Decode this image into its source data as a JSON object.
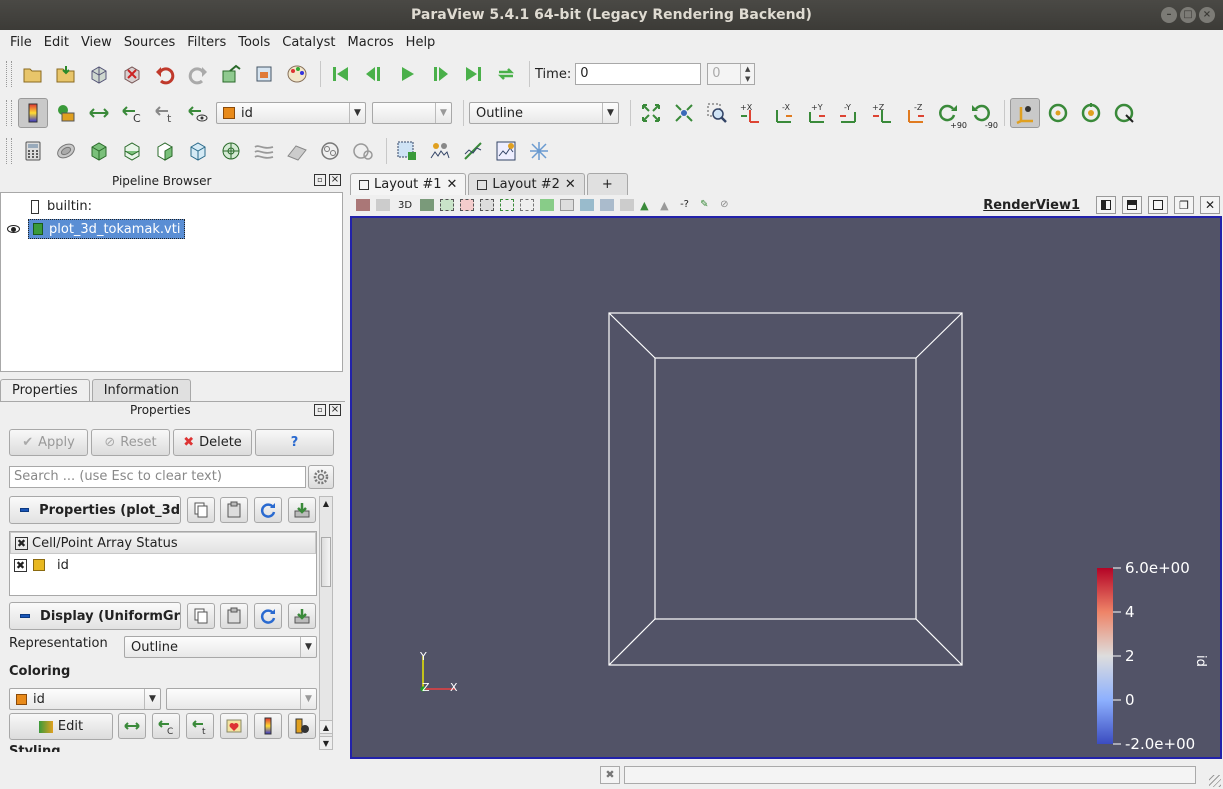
{
  "window": {
    "title": "ParaView 5.4.1 64-bit (Legacy Rendering Backend)"
  },
  "menu": [
    "File",
    "Edit",
    "View",
    "Sources",
    "Filters",
    "Tools",
    "Catalyst",
    "Macros",
    "Help"
  ],
  "time": {
    "label": "Time:",
    "value": "0",
    "index": "0"
  },
  "color_toolbar": {
    "array": "id",
    "component": "",
    "representation": "Outline"
  },
  "view_buttons": {
    "plus_90": "+90",
    "minus_90": "-90"
  },
  "pipeline": {
    "title": "Pipeline Browser",
    "items": [
      {
        "label": "builtin:"
      },
      {
        "label": "plot_3d_tokamak.vti"
      }
    ]
  },
  "panel_tabs": [
    "Properties",
    "Information"
  ],
  "properties": {
    "title": "Properties",
    "apply": "Apply",
    "reset": "Reset",
    "delete": "Delete",
    "help": "?",
    "search_placeholder": "Search ... (use Esc to clear text)",
    "section_properties": "Properties (plot_3d",
    "array_header": "Cell/Point Array Status",
    "array_item": "id",
    "section_display": "Display (UniformGr",
    "representation_label": "Representation",
    "representation_value": "Outline",
    "coloring_label": "Coloring",
    "coloring_value": "id",
    "edit": "Edit",
    "styling_label": "Styling"
  },
  "layout_tabs": [
    "Layout #1",
    "Layout #2",
    "+"
  ],
  "render_view": {
    "name": "RenderView1",
    "toolbar_3d": "3D",
    "background": "#525367",
    "axes": {
      "y": "Y",
      "z": "Z",
      "x": "X"
    },
    "colorbar": {
      "title": "id",
      "ticks": [
        "6.0e+00",
        "4",
        "2",
        "0",
        "-2.0e+00"
      ],
      "range": [
        -2,
        6
      ]
    }
  }
}
